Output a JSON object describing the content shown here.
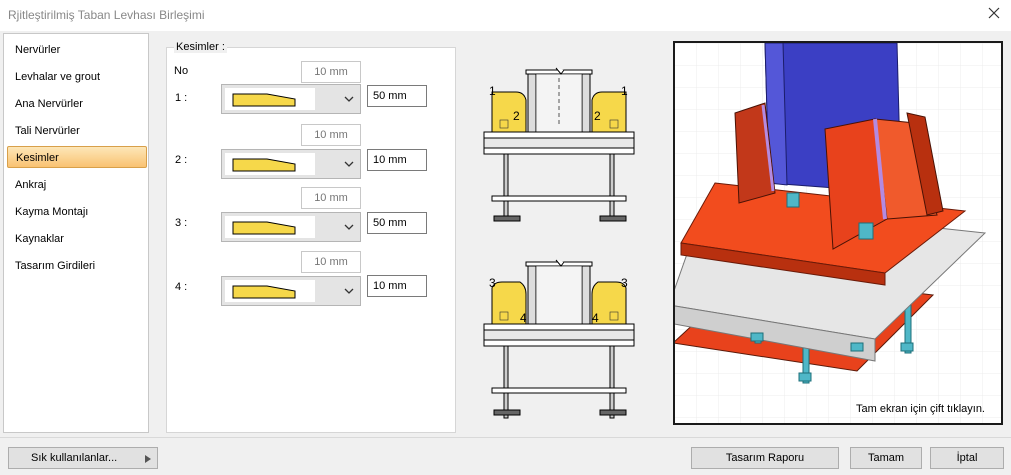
{
  "window": {
    "title": "Rjitleştirilmiş Taban Levhası Birleşimi"
  },
  "sidebar": {
    "items": [
      {
        "label": "Nervürler"
      },
      {
        "label": "Levhalar ve grout"
      },
      {
        "label": "Ana Nervürler"
      },
      {
        "label": "Tali Nervürler"
      },
      {
        "label": "Kesimler",
        "active": true
      },
      {
        "label": "Ankraj"
      },
      {
        "label": "Kayma Montajı"
      },
      {
        "label": "Kaynaklar"
      },
      {
        "label": "Tasarım Girdileri"
      }
    ]
  },
  "cuts": {
    "group_label": "Kesimler :",
    "no_label": "No",
    "rows": [
      {
        "label": "1 :",
        "top_value": "10 mm",
        "value": "50 mm"
      },
      {
        "label": "2 :",
        "top_value": "10 mm",
        "value": "10 mm"
      },
      {
        "label": "3 :",
        "top_value": "10 mm",
        "value": "50 mm"
      },
      {
        "label": "4 :",
        "top_value": "10 mm",
        "value": "10 mm"
      }
    ]
  },
  "diagram": {
    "top": {
      "left_num": "1",
      "right_num": "1",
      "inner_left": "2",
      "inner_right": "2"
    },
    "bottom": {
      "left_num": "3",
      "right_num": "3",
      "inner_left": "4",
      "inner_right": "4"
    }
  },
  "preview": {
    "hint": "Tam ekran için çift tıklayın."
  },
  "footer": {
    "favorites": "Sık kullanılanlar...",
    "report": "Tasarım Raporu",
    "ok": "Tamam",
    "cancel": "İptal"
  },
  "colors": {
    "accent_active": "#f9c272",
    "plate_red": "#e8421c",
    "column_blue": "#3b3fc4",
    "stiffener_yellow": "#f6d84a"
  }
}
